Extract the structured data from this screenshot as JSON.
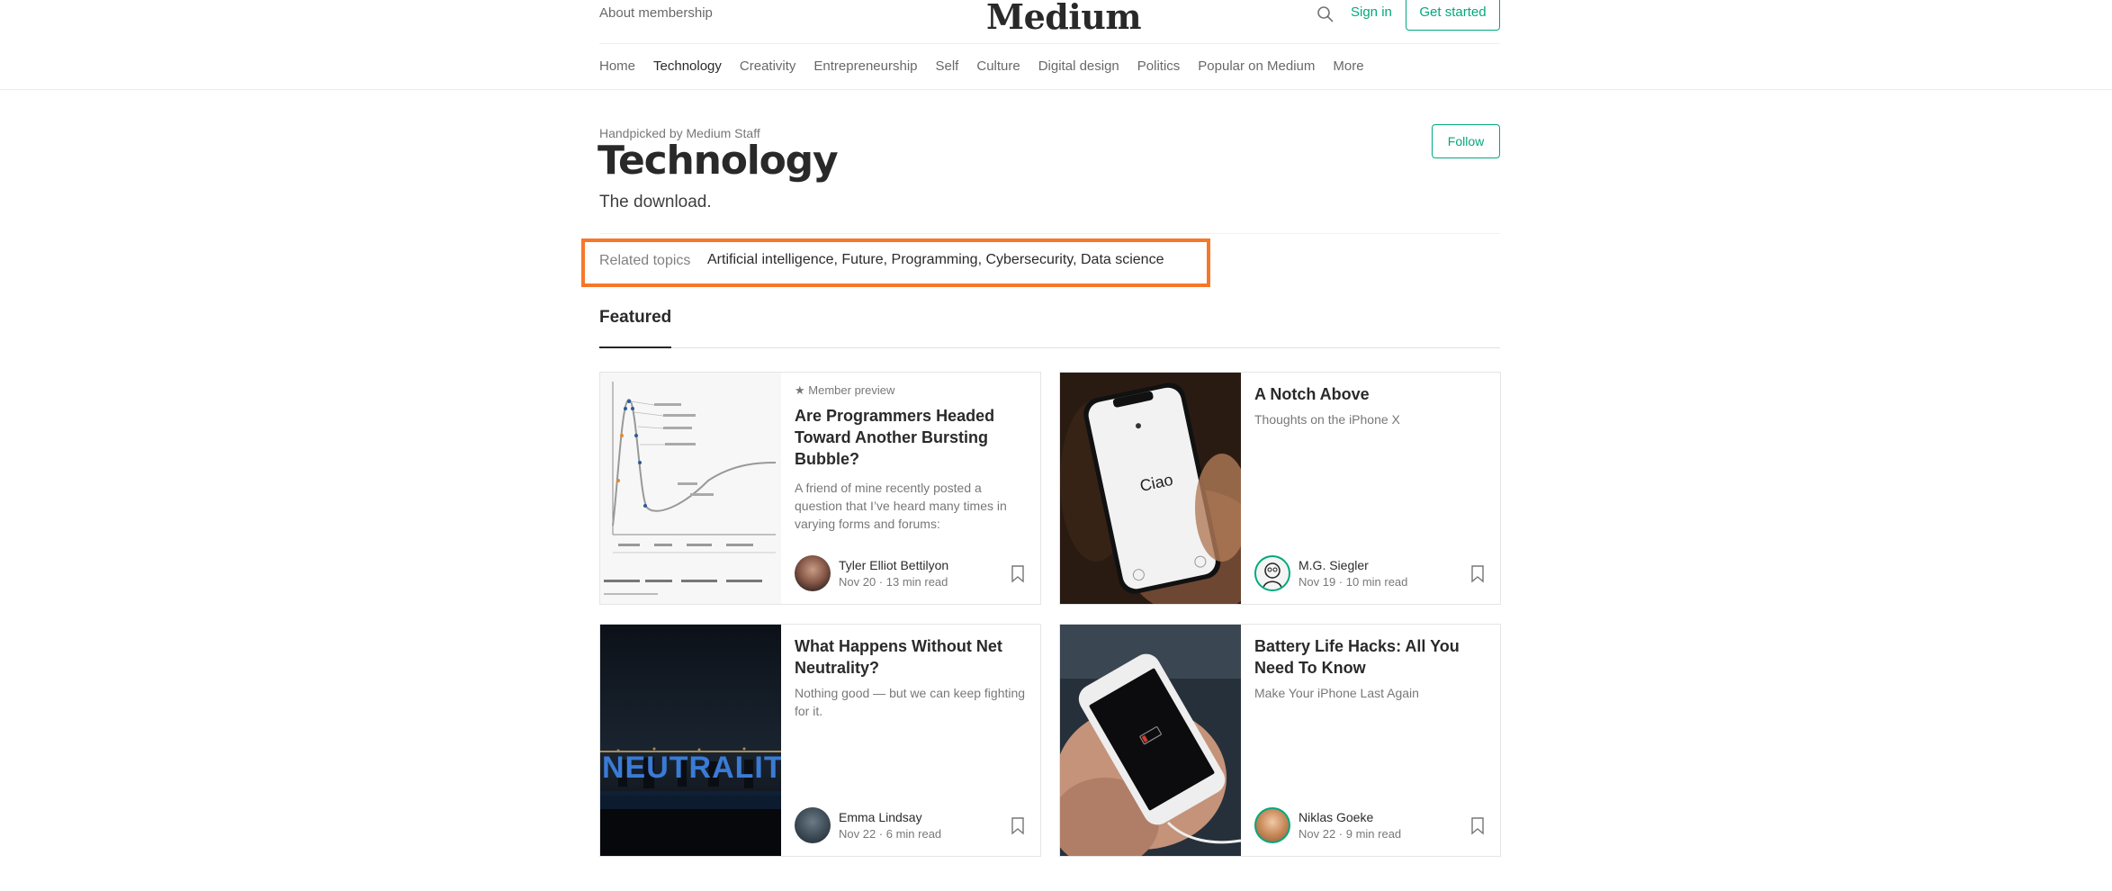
{
  "header": {
    "about": "About membership",
    "logo": "Medium",
    "sign_in": "Sign in",
    "get_started": "Get started"
  },
  "nav": [
    "Home",
    "Technology",
    "Creativity",
    "Entrepreneurship",
    "Self",
    "Culture",
    "Digital design",
    "Politics",
    "Popular on Medium",
    "More"
  ],
  "nav_active": "Technology",
  "hero": {
    "handpicked": "Handpicked by Medium Staff",
    "title": "Technology",
    "subtitle": "The download.",
    "follow": "Follow"
  },
  "related": {
    "label": "Related topics",
    "topics": [
      "Artificial intelligence",
      "Future",
      "Programming",
      "Cybersecurity",
      "Data science"
    ]
  },
  "featured": {
    "heading": "Featured",
    "cards": [
      {
        "member": "Member preview",
        "title": "Are Programmers Headed Toward Another Bursting Bubble?",
        "subtitle": "A friend of mine recently posted a question that I’ve heard many times in varying forms and forums:",
        "author": "Tyler Elliot Bettilyon",
        "meta": "Nov 20 · 13 min read"
      },
      {
        "member": "",
        "title": "A Notch Above",
        "subtitle": "Thoughts on the iPhone X",
        "author": "M.G. Siegler",
        "meta": "Nov 19 · 10 min read",
        "thumb_text": "Ciao"
      },
      {
        "member": "",
        "title": "What Happens Without Net Neutrality?",
        "subtitle": "Nothing good — but we can keep fighting for it.",
        "author": "Emma Lindsay",
        "meta": "Nov 22 · 6 min read",
        "thumb_text": "NEUTRALITY"
      },
      {
        "member": "",
        "title": "Battery Life Hacks: All You Need To Know",
        "subtitle": "Make Your iPhone Last Again",
        "author": "Niklas Goeke",
        "meta": "Nov 22 · 9 min read"
      }
    ]
  },
  "colors": {
    "accent": "#03a87c",
    "highlight": "#f5782a"
  },
  "icons": {
    "search": "search-icon",
    "bookmark": "bookmark-icon",
    "star": "star-icon"
  }
}
